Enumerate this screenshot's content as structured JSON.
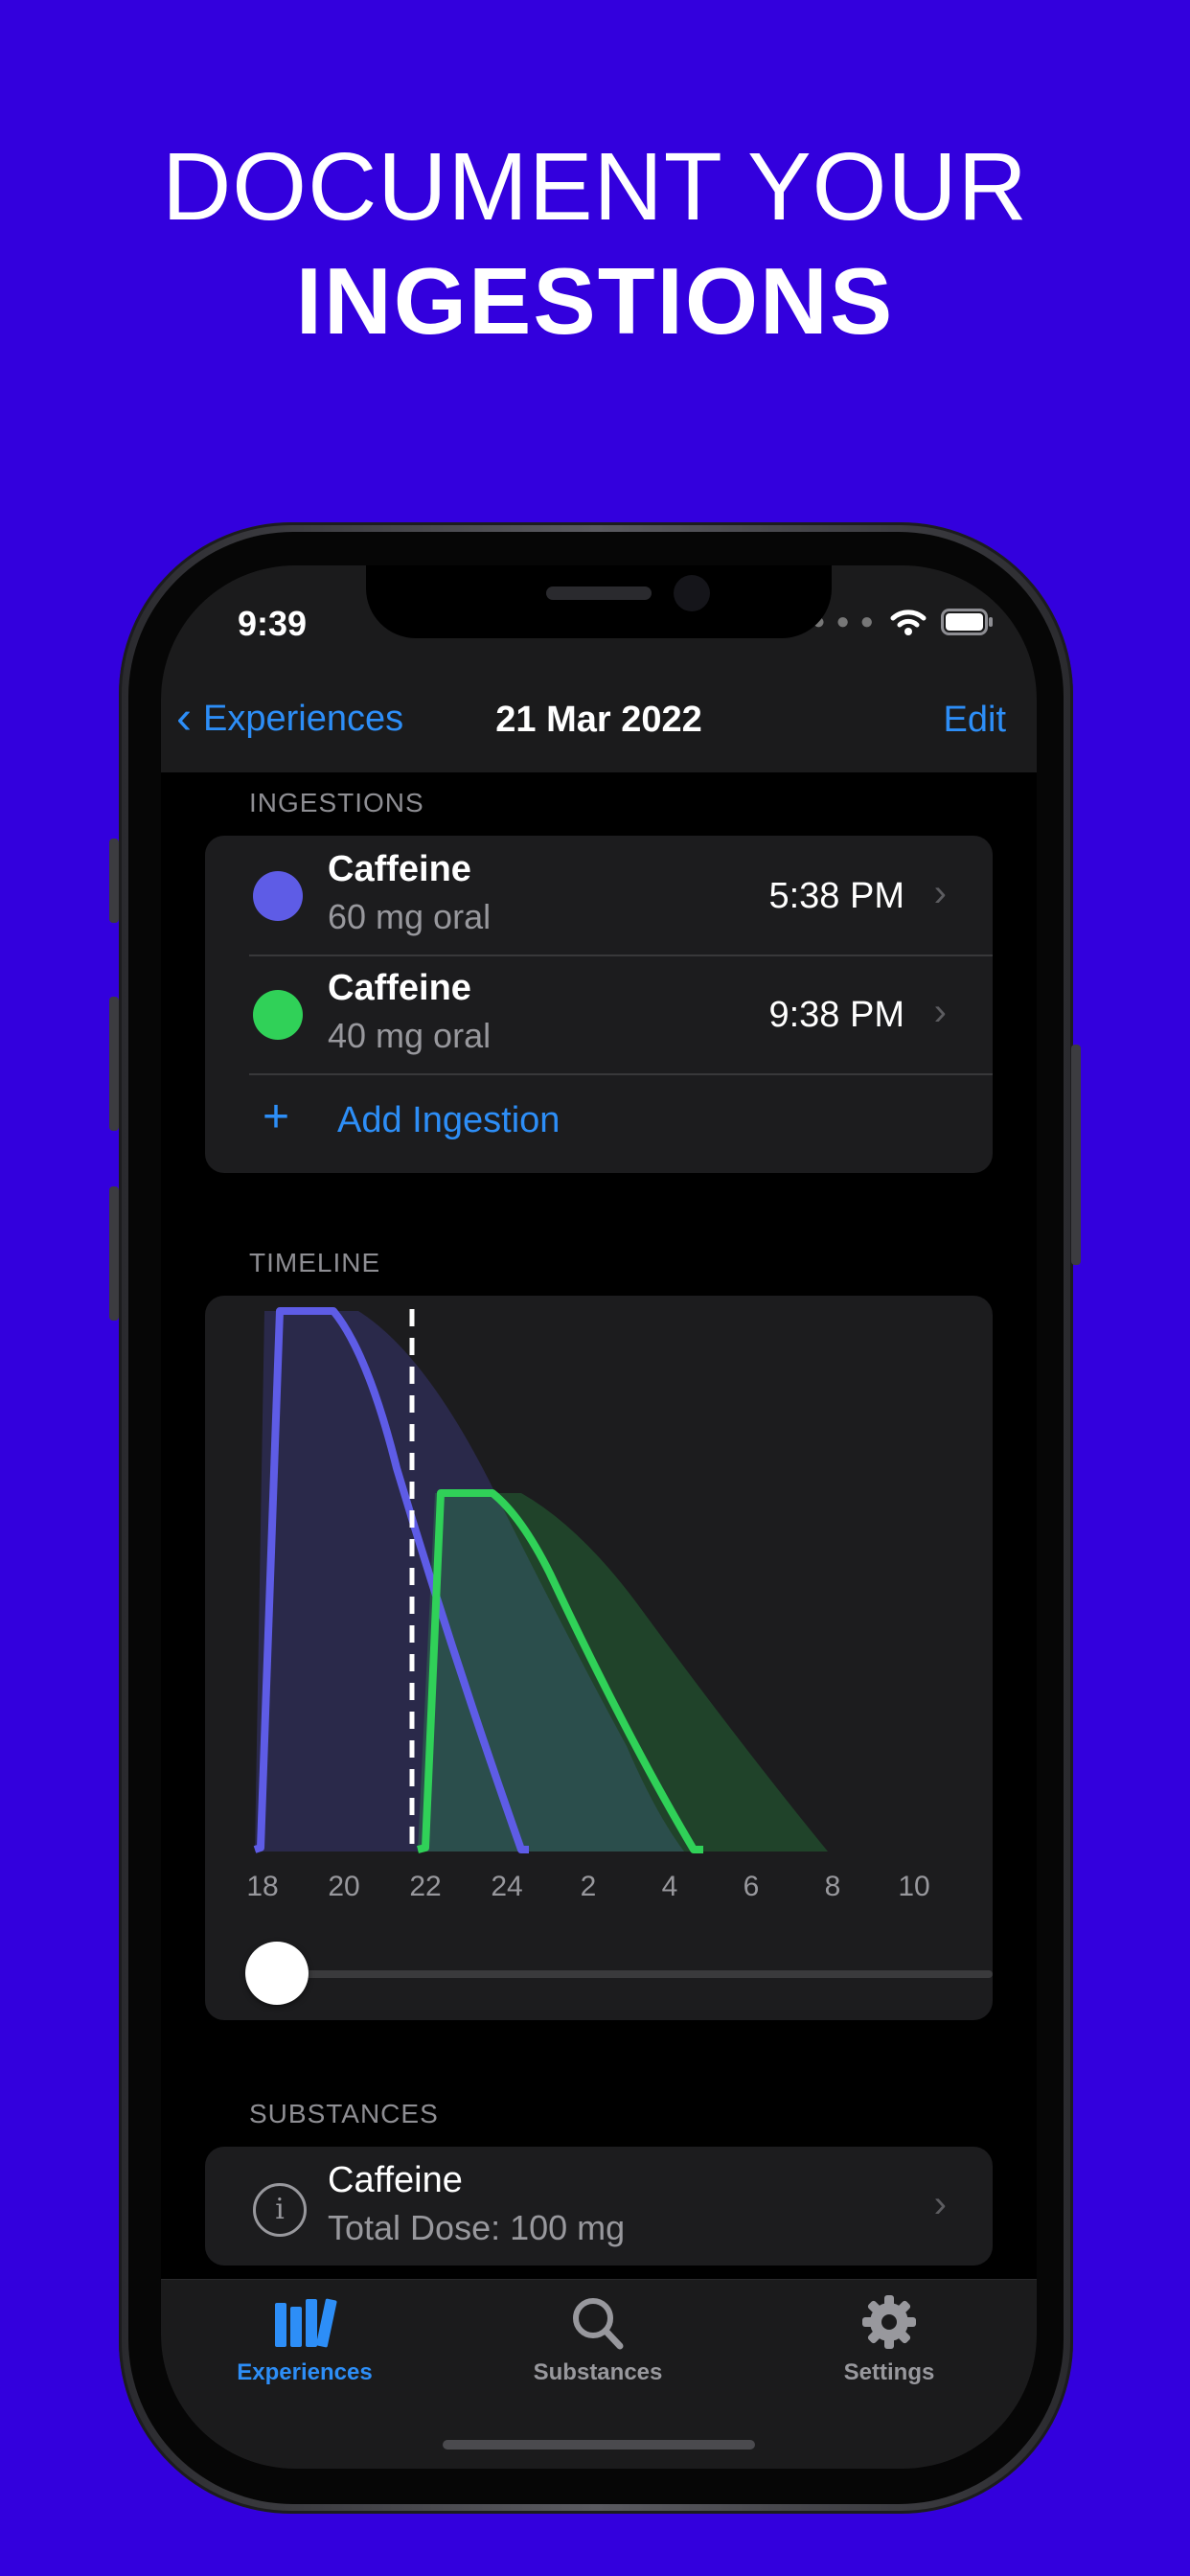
{
  "headline": {
    "line1": "DOCUMENT YOUR",
    "line2": "INGESTIONS"
  },
  "status_bar": {
    "time": "9:39"
  },
  "nav": {
    "back_label": "Experiences",
    "title": "21 Mar 2022",
    "edit_label": "Edit"
  },
  "ingestions": {
    "section_label": "INGESTIONS",
    "items": [
      {
        "name": "Caffeine",
        "detail": "60 mg oral",
        "time": "5:38 PM",
        "color": "#5E5CE6"
      },
      {
        "name": "Caffeine",
        "detail": "40 mg oral",
        "time": "9:38 PM",
        "color": "#30D158"
      }
    ],
    "add_label": "Add Ingestion"
  },
  "timeline": {
    "section_label": "TIMELINE",
    "ticks": [
      "18",
      "20",
      "22",
      "24",
      "2",
      "4",
      "6",
      "8",
      "10"
    ],
    "slider_value": 0
  },
  "substances": {
    "section_label": "SUBSTANCES",
    "items": [
      {
        "name": "Caffeine",
        "detail": "Total Dose: 100 mg"
      }
    ]
  },
  "tabs": [
    {
      "label": "Experiences",
      "icon": "books-icon",
      "active": true
    },
    {
      "label": "Substances",
      "icon": "magnifier-icon",
      "active": false
    },
    {
      "label": "Settings",
      "icon": "gear-icon",
      "active": false
    }
  ],
  "colors": {
    "accent": "#2D8EF7",
    "background": "#3300DD",
    "tab_inactive": "#98989D"
  }
}
